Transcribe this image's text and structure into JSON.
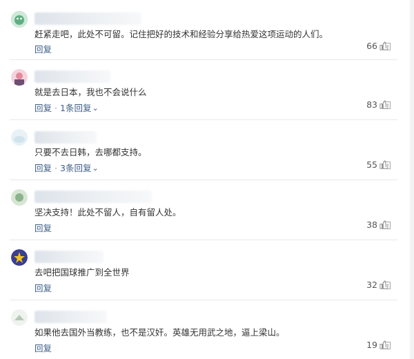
{
  "comments": [
    {
      "text": "赶紧走吧，此处不可留。记住把好的技术和经验分享给热爱这项运动的人们。",
      "reply_label": "回复",
      "replies_label": "",
      "likes": "66",
      "avatar_color": "#7bbf9b"
    },
    {
      "text": "就是去日本，我也不会说什么",
      "reply_label": "回复",
      "replies_label": "1条回复",
      "likes": "83",
      "avatar_color": "#e28a9c"
    },
    {
      "text": "只要不去日韩，去哪都支持。",
      "reply_label": "回复",
      "replies_label": "3条回复",
      "likes": "55",
      "avatar_color": "#cfe4ef"
    },
    {
      "text": "坚决支持！此处不留人，自有留人处。",
      "reply_label": "回复",
      "replies_label": "",
      "likes": "38",
      "avatar_color": "#8bb48c"
    },
    {
      "text": "去吧把国球推广到全世界",
      "reply_label": "回复",
      "replies_label": "",
      "likes": "32",
      "avatar_color": "#3a3f8f"
    },
    {
      "text": "如果他去国外当教练，也不是汉奸。英雄无用武之地，逼上梁山。",
      "reply_label": "回复",
      "replies_label": "",
      "likes": "19",
      "avatar_color": "#dfe9df"
    }
  ]
}
